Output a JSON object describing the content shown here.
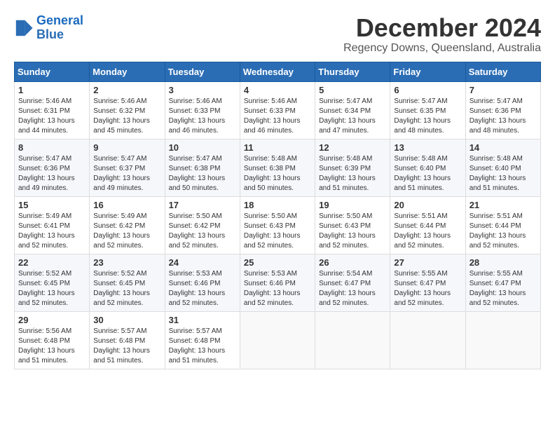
{
  "header": {
    "logo_line1": "General",
    "logo_line2": "Blue",
    "month_title": "December 2024",
    "subtitle": "Regency Downs, Queensland, Australia"
  },
  "weekdays": [
    "Sunday",
    "Monday",
    "Tuesday",
    "Wednesday",
    "Thursday",
    "Friday",
    "Saturday"
  ],
  "weeks": [
    [
      {
        "day": "1",
        "sunrise": "5:46 AM",
        "sunset": "6:31 PM",
        "daylight": "13 hours and 44 minutes."
      },
      {
        "day": "2",
        "sunrise": "5:46 AM",
        "sunset": "6:32 PM",
        "daylight": "13 hours and 45 minutes."
      },
      {
        "day": "3",
        "sunrise": "5:46 AM",
        "sunset": "6:33 PM",
        "daylight": "13 hours and 46 minutes."
      },
      {
        "day": "4",
        "sunrise": "5:46 AM",
        "sunset": "6:33 PM",
        "daylight": "13 hours and 46 minutes."
      },
      {
        "day": "5",
        "sunrise": "5:47 AM",
        "sunset": "6:34 PM",
        "daylight": "13 hours and 47 minutes."
      },
      {
        "day": "6",
        "sunrise": "5:47 AM",
        "sunset": "6:35 PM",
        "daylight": "13 hours and 48 minutes."
      },
      {
        "day": "7",
        "sunrise": "5:47 AM",
        "sunset": "6:36 PM",
        "daylight": "13 hours and 48 minutes."
      }
    ],
    [
      {
        "day": "8",
        "sunrise": "5:47 AM",
        "sunset": "6:36 PM",
        "daylight": "13 hours and 49 minutes."
      },
      {
        "day": "9",
        "sunrise": "5:47 AM",
        "sunset": "6:37 PM",
        "daylight": "13 hours and 49 minutes."
      },
      {
        "day": "10",
        "sunrise": "5:47 AM",
        "sunset": "6:38 PM",
        "daylight": "13 hours and 50 minutes."
      },
      {
        "day": "11",
        "sunrise": "5:48 AM",
        "sunset": "6:38 PM",
        "daylight": "13 hours and 50 minutes."
      },
      {
        "day": "12",
        "sunrise": "5:48 AM",
        "sunset": "6:39 PM",
        "daylight": "13 hours and 51 minutes."
      },
      {
        "day": "13",
        "sunrise": "5:48 AM",
        "sunset": "6:40 PM",
        "daylight": "13 hours and 51 minutes."
      },
      {
        "day": "14",
        "sunrise": "5:48 AM",
        "sunset": "6:40 PM",
        "daylight": "13 hours and 51 minutes."
      }
    ],
    [
      {
        "day": "15",
        "sunrise": "5:49 AM",
        "sunset": "6:41 PM",
        "daylight": "13 hours and 52 minutes."
      },
      {
        "day": "16",
        "sunrise": "5:49 AM",
        "sunset": "6:42 PM",
        "daylight": "13 hours and 52 minutes."
      },
      {
        "day": "17",
        "sunrise": "5:50 AM",
        "sunset": "6:42 PM",
        "daylight": "13 hours and 52 minutes."
      },
      {
        "day": "18",
        "sunrise": "5:50 AM",
        "sunset": "6:43 PM",
        "daylight": "13 hours and 52 minutes."
      },
      {
        "day": "19",
        "sunrise": "5:50 AM",
        "sunset": "6:43 PM",
        "daylight": "13 hours and 52 minutes."
      },
      {
        "day": "20",
        "sunrise": "5:51 AM",
        "sunset": "6:44 PM",
        "daylight": "13 hours and 52 minutes."
      },
      {
        "day": "21",
        "sunrise": "5:51 AM",
        "sunset": "6:44 PM",
        "daylight": "13 hours and 52 minutes."
      }
    ],
    [
      {
        "day": "22",
        "sunrise": "5:52 AM",
        "sunset": "6:45 PM",
        "daylight": "13 hours and 52 minutes."
      },
      {
        "day": "23",
        "sunrise": "5:52 AM",
        "sunset": "6:45 PM",
        "daylight": "13 hours and 52 minutes."
      },
      {
        "day": "24",
        "sunrise": "5:53 AM",
        "sunset": "6:46 PM",
        "daylight": "13 hours and 52 minutes."
      },
      {
        "day": "25",
        "sunrise": "5:53 AM",
        "sunset": "6:46 PM",
        "daylight": "13 hours and 52 minutes."
      },
      {
        "day": "26",
        "sunrise": "5:54 AM",
        "sunset": "6:47 PM",
        "daylight": "13 hours and 52 minutes."
      },
      {
        "day": "27",
        "sunrise": "5:55 AM",
        "sunset": "6:47 PM",
        "daylight": "13 hours and 52 minutes."
      },
      {
        "day": "28",
        "sunrise": "5:55 AM",
        "sunset": "6:47 PM",
        "daylight": "13 hours and 52 minutes."
      }
    ],
    [
      {
        "day": "29",
        "sunrise": "5:56 AM",
        "sunset": "6:48 PM",
        "daylight": "13 hours and 51 minutes."
      },
      {
        "day": "30",
        "sunrise": "5:57 AM",
        "sunset": "6:48 PM",
        "daylight": "13 hours and 51 minutes."
      },
      {
        "day": "31",
        "sunrise": "5:57 AM",
        "sunset": "6:48 PM",
        "daylight": "13 hours and 51 minutes."
      },
      null,
      null,
      null,
      null
    ]
  ]
}
